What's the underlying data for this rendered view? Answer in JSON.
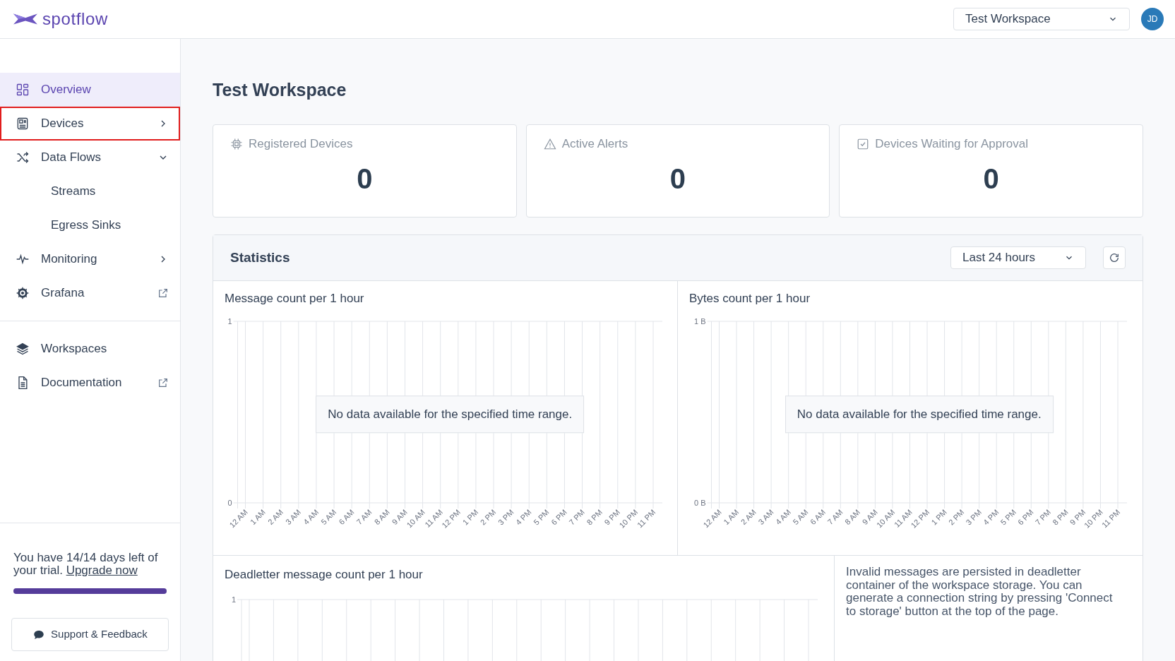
{
  "header": {
    "logo": "spotflow",
    "workspace_select": {
      "value": "Test Workspace"
    },
    "avatar": "JD"
  },
  "sidebar": {
    "items": [
      {
        "label": "Overview",
        "kind": "link",
        "selected": true,
        "highlighted": false
      },
      {
        "label": "Devices",
        "kind": "group",
        "expanded": false,
        "selected": false,
        "highlighted": true
      },
      {
        "label": "Data Flows",
        "kind": "group",
        "expanded": true,
        "selected": false,
        "highlighted": false,
        "children": [
          {
            "label": "Streams",
            "selected": false,
            "highlighted": false
          },
          {
            "label": "Egress Sinks",
            "selected": false,
            "highlighted": false
          }
        ]
      },
      {
        "label": "Monitoring",
        "kind": "group",
        "expanded": false,
        "selected": false,
        "highlighted": false
      },
      {
        "label": "Grafana",
        "kind": "external",
        "selected": false,
        "highlighted": false
      }
    ],
    "secondary_items": [
      {
        "label": "Workspaces",
        "kind": "link",
        "selected": false,
        "highlighted": false
      },
      {
        "label": "Documentation",
        "kind": "external",
        "selected": false,
        "highlighted": false
      }
    ],
    "trial": {
      "text": "You have 14/14 days left of your trial.",
      "link": "Upgrade now",
      "level": 1
    },
    "support_button": "Support & Feedback"
  },
  "page_title": "Test Workspace",
  "stat_cards": [
    {
      "label": "Registered Devices",
      "value": "0"
    },
    {
      "label": "Active Alerts",
      "value": "0"
    },
    {
      "label": "Devices Waiting for Approval",
      "value": "0"
    }
  ],
  "statistics": {
    "title": "Statistics",
    "range_select": {
      "value": "Last 24 hours"
    },
    "charts": [
      {
        "message": "No data available for the specified time range.",
        "chart_data": {
          "type": "line",
          "title": "Message count per 1 hour",
          "categories": [
            "12 AM",
            "1 AM",
            "2 AM",
            "3 AM",
            "4 AM",
            "5 AM",
            "6 AM",
            "7 AM",
            "8 AM",
            "9 AM",
            "10 AM",
            "11 AM",
            "12 PM",
            "1 PM",
            "2 PM",
            "3 PM",
            "4 PM",
            "5 PM",
            "6 PM",
            "7 PM",
            "8 PM",
            "9 PM",
            "10 PM",
            "11 PM"
          ],
          "ylim": [
            0,
            1
          ],
          "yticks": [
            0,
            1
          ]
        }
      },
      {
        "message": "No data available for the specified time range.",
        "chart_data": {
          "type": "line",
          "title": "Bytes count per 1 hour",
          "categories": [
            "12 AM",
            "1 AM",
            "2 AM",
            "3 AM",
            "4 AM",
            "5 AM",
            "6 AM",
            "7 AM",
            "8 AM",
            "9 AM",
            "10 AM",
            "11 AM",
            "12 PM",
            "1 PM",
            "2 PM",
            "3 PM",
            "4 PM",
            "5 PM",
            "6 PM",
            "7 PM",
            "8 PM",
            "9 PM",
            "10 PM",
            "11 PM"
          ],
          "ylim": [
            0,
            1
          ],
          "yticks": [
            {
              "value": 0,
              "label": "0 B"
            },
            {
              "value": 1,
              "label": "1 B"
            }
          ]
        }
      },
      {
        "title": "Deadletter message count per 1 hour",
        "axis_label": "1"
      }
    ],
    "deadletter_info": "Invalid messages are persisted in deadletter container of the workspace storage. You can generate a connection string by pressing 'Connect to storage' button at the top of the page."
  }
}
